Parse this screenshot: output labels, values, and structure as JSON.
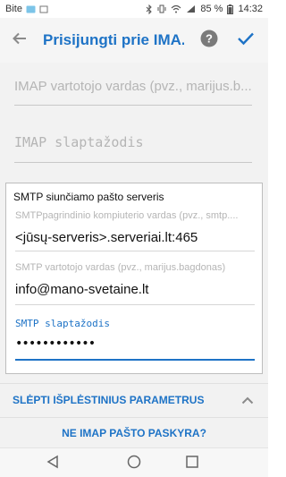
{
  "status": {
    "carrier": "Bite",
    "battery": "85 %",
    "time": "14:32"
  },
  "header": {
    "title": "Prisijungti prie IMA...",
    "icons": [
      "back-arrow-icon",
      "help-icon",
      "check-icon"
    ]
  },
  "imap": {
    "username_placeholder": "IMAP vartotojo vardas (pvz., marijus.b...",
    "password_placeholder": "IMAP slaptažodis"
  },
  "smtp": {
    "section_title": "SMTP siunčiamo pašto serveris",
    "server_label": "SMTPpagrindinio kompiuterio vardas (pvz., smtp....",
    "server_value": "<jūsų-serveris>.serveriai.lt:465",
    "user_label": "SMTP vartotojo vardas (pvz., marijus.bagdonas)",
    "user_value": "info@mano-svetaine.lt",
    "password_label": "SMTP slaptažodis",
    "password_value": "••••••••••••"
  },
  "links": {
    "hide_advanced": "SLĖPTI IŠPLĖSTINIUS PARAMETRUS",
    "not_imap": "NE IMAP PAŠTO PASKYRA?"
  },
  "colors": {
    "accent": "#1e73c6",
    "background": "#f2f2f2"
  }
}
